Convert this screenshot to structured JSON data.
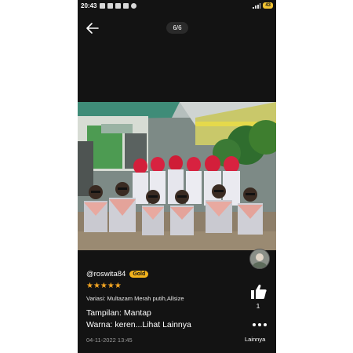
{
  "status_bar": {
    "time": "20:43",
    "battery": "43"
  },
  "viewer": {
    "counter": "6/6",
    "back_icon": "arrow-left-icon"
  },
  "review": {
    "username": "@roswita84",
    "badge": "Gold",
    "rating": 5,
    "stars": "★★★★★",
    "variant": "Variasi: Multazam Merah putih,Allsize",
    "line1": "Tampilan: Mantap",
    "line2": "Warna: keren...Lihat Lainnya",
    "date": "04-11-2022 13:45"
  },
  "actions": {
    "like_count": "1",
    "more_label": "Lainnya"
  },
  "colors": {
    "background": "#131313",
    "badge": "#f2b21c",
    "star": "#f5a623"
  }
}
